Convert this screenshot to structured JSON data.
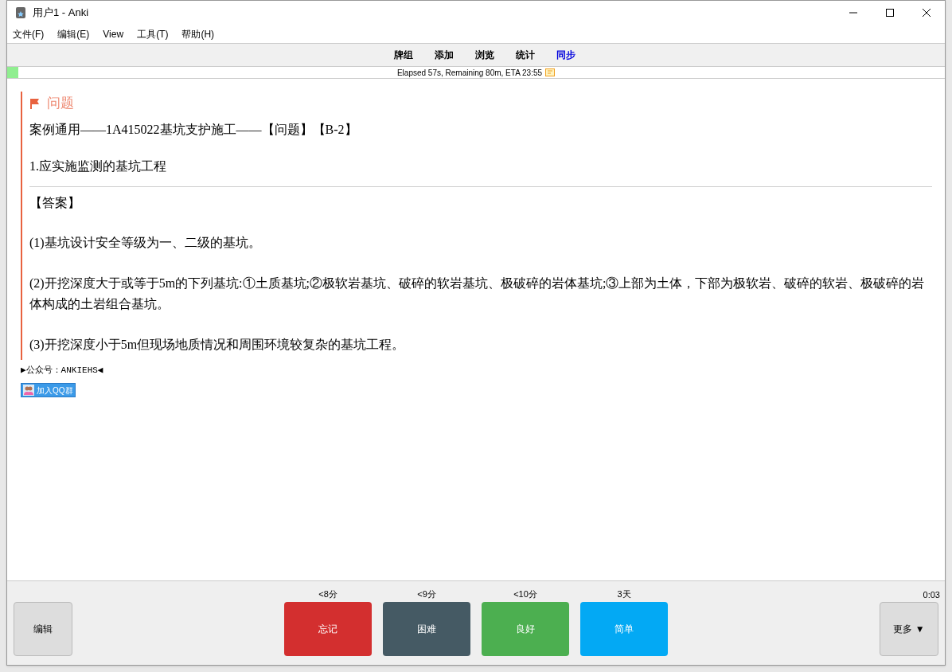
{
  "window": {
    "title": "用户1 - Anki"
  },
  "menu": [
    "文件(F)",
    "编辑(E)",
    "View",
    "工具(T)",
    "帮助(H)"
  ],
  "toolbar": [
    {
      "label": "牌组",
      "attention": false
    },
    {
      "label": "添加",
      "attention": false
    },
    {
      "label": "浏览",
      "attention": false
    },
    {
      "label": "统计",
      "attention": false
    },
    {
      "label": "同步",
      "attention": true
    }
  ],
  "progress": {
    "level": 0.012,
    "text": "Elapsed 57s, Remaining 80m, ETA 23:55"
  },
  "card": {
    "heading": "问题",
    "title": "案例通用——1A415022基坑支护施工——【问题】【B-2】",
    "question": "1.应实施监测的基坑工程",
    "answer_label": "【答案】",
    "paragraphs": [
      "(1)基坑设计安全等级为一、二级的基坑。",
      "(2)开挖深度大于或等于5m的下列基坑:①土质基坑;②极软岩基坑、破碎的软岩基坑、极破碎的岩体基坑;③上部为土体，下部为极软岩、破碎的软岩、极破碎的岩体构成的土岩组合基坑。",
      "(3)开挖深度小于5m但现场地质情况和周围环境较复杂的基坑工程。"
    ],
    "footer": "▶公众号：ANKIEHS◀",
    "qq_button": "加入QQ群"
  },
  "bottom": {
    "edit": "编辑",
    "timer": "0:03",
    "more": "更多 ▼",
    "answers": [
      {
        "interval": "<8分",
        "label": "忘记",
        "color": "#d32f2f"
      },
      {
        "interval": "<9分",
        "label": "困难",
        "color": "#455a64"
      },
      {
        "interval": "<10分",
        "label": "良好",
        "color": "#4caf50"
      },
      {
        "interval": "3天",
        "label": "简单",
        "color": "#03a9f4"
      }
    ]
  }
}
